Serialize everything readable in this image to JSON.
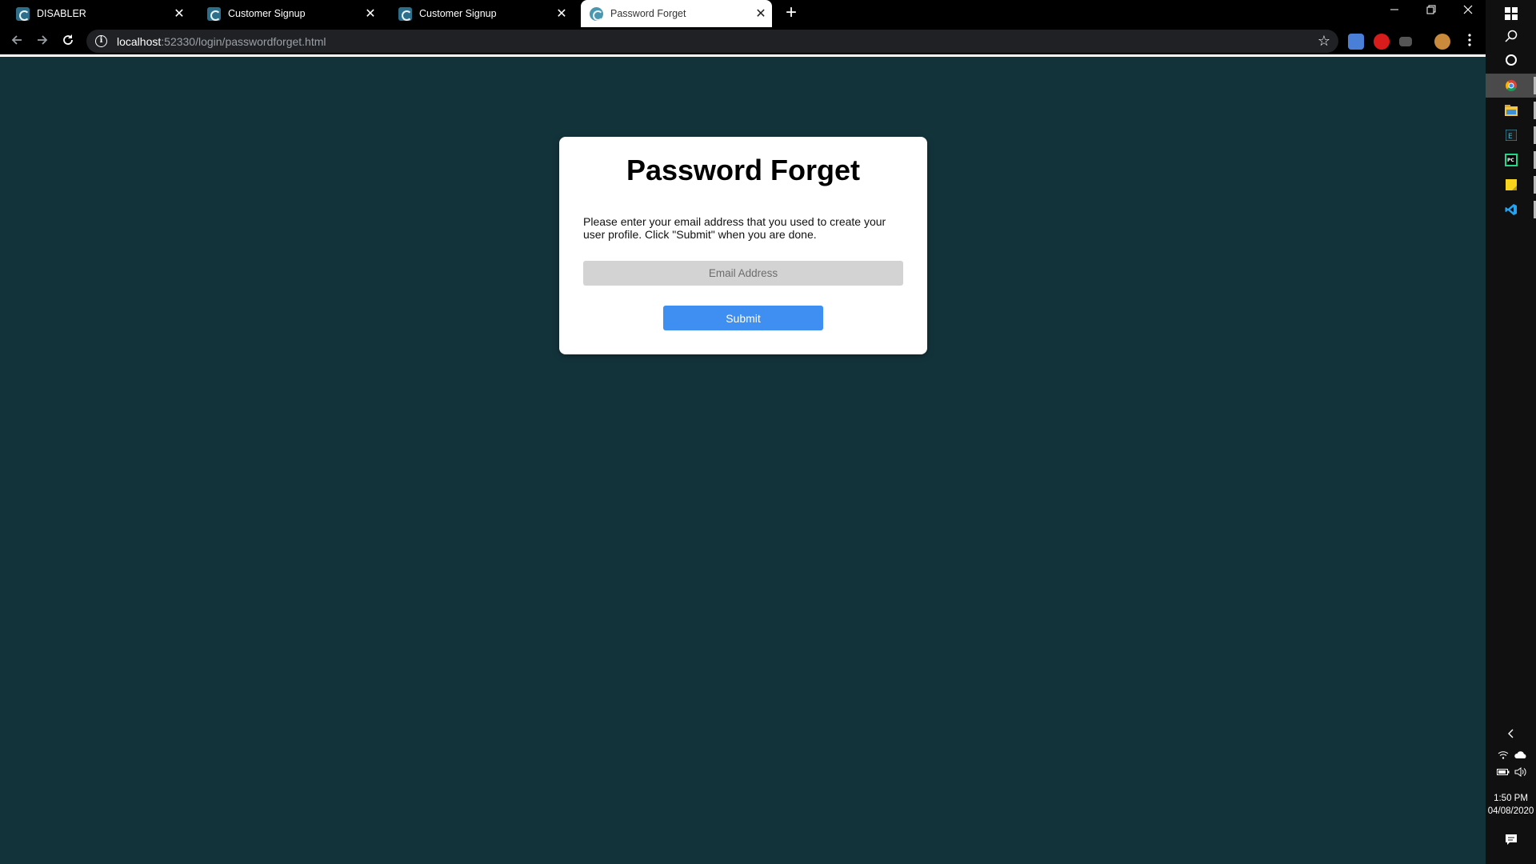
{
  "browser": {
    "tabs": [
      {
        "title": "DISABLER",
        "active": false
      },
      {
        "title": "Customer Signup",
        "active": false
      },
      {
        "title": "Customer Signup",
        "active": false
      },
      {
        "title": "Password Forget",
        "active": true
      }
    ],
    "close_glyph": "✕",
    "new_tab_glyph": "+",
    "address": {
      "host": "localhost",
      "path": ":52330/login/passwordforget.html"
    }
  },
  "page": {
    "title": "Password Forget",
    "instructions": "Please enter your email address that you used to create your user profile. Click \"Submit\" when you are done.",
    "email_placeholder": "Email Address",
    "submit_label": "Submit"
  },
  "taskbar": {
    "time": "1:50 PM",
    "date": "04/08/2020"
  },
  "colors": {
    "page_background": "#13333b",
    "submit_button": "#3f8ef2",
    "email_field": "#d3d3d3"
  }
}
